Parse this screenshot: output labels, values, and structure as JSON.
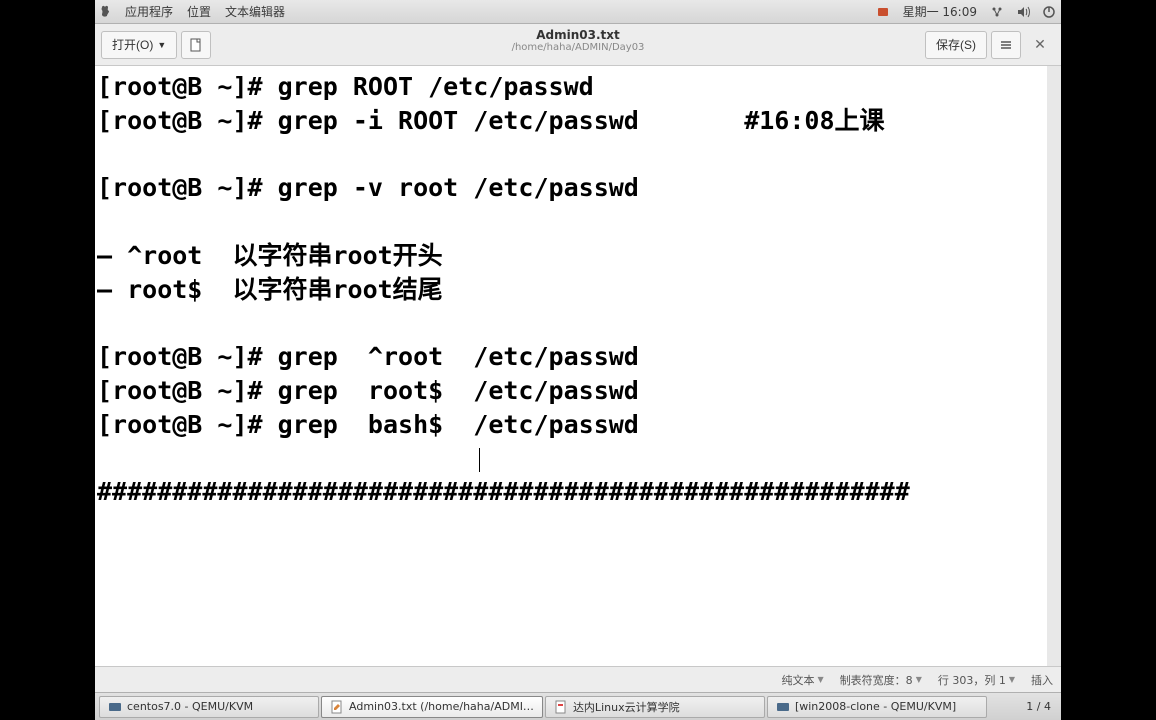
{
  "topbar": {
    "menu_apps": "应用程序",
    "menu_places": "位置",
    "menu_editor": "文本编辑器",
    "clock": "星期一 16:09"
  },
  "toolbar": {
    "open_label": "打开(O)",
    "save_label": "保存(S)",
    "title": "Admin03.txt",
    "subtitle": "/home/haha/ADMIN/Day03"
  },
  "content": {
    "line1": "[root@B ~]# grep ROOT /etc/passwd",
    "line2": "[root@B ~]# grep -i ROOT /etc/passwd       #16:08上课",
    "line3": "",
    "line4": "[root@B ~]# grep -v root /etc/passwd",
    "line5": "",
    "line6": "– ^root  以字符串root开头",
    "line7": "– root$  以字符串root结尾",
    "line8": "",
    "line9": "[root@B ~]# grep  ^root  /etc/passwd",
    "line10": "[root@B ~]# grep  root$  /etc/passwd",
    "line11": "[root@B ~]# grep  bash$  /etc/passwd",
    "line12": "",
    "line13": "######################################################"
  },
  "statusbar": {
    "syntax": "纯文本",
    "tabwidth": "制表符宽度：8",
    "position": "行 303，列 1",
    "mode": "插入"
  },
  "taskbar": {
    "item1": "centos7.0 - QEMU/KVM",
    "item2": "Admin03.txt (/home/haha/ADMI…",
    "item3": "达内Linux云计算学院",
    "item4": "[win2008-clone - QEMU/KVM]",
    "pages": "1 / 4"
  }
}
